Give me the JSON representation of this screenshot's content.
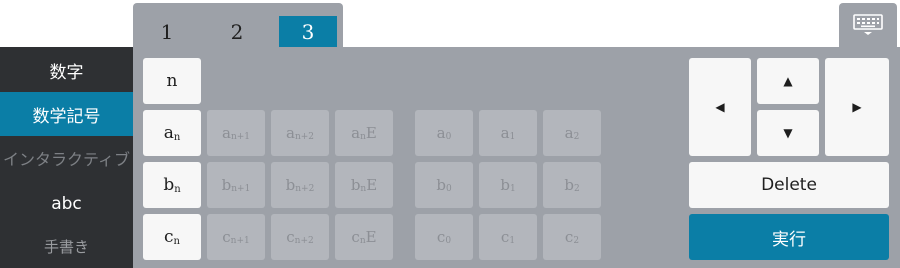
{
  "tabs": [
    {
      "label": "1",
      "active": false
    },
    {
      "label": "2",
      "active": false
    },
    {
      "label": "3",
      "active": true
    }
  ],
  "sidebar": [
    {
      "label": "数字",
      "active": false
    },
    {
      "label": "数学記号",
      "active": true
    },
    {
      "label": "インタラクティブ",
      "active": false,
      "dim": true
    },
    {
      "label": "abc",
      "active": false
    },
    {
      "label": "手書き",
      "active": false,
      "dim": true
    }
  ],
  "keys": {
    "n": "n",
    "a_n": {
      "base": "a",
      "sub": "n"
    },
    "a_n1": {
      "base": "a",
      "sub": "n+1"
    },
    "a_n2": {
      "base": "a",
      "sub": "n+2"
    },
    "a_nE": {
      "base": "a",
      "sub": "n",
      "suffix": "E"
    },
    "a_0": {
      "base": "a",
      "sub": "0"
    },
    "a_1": {
      "base": "a",
      "sub": "1"
    },
    "a_2": {
      "base": "a",
      "sub": "2"
    },
    "b_n": {
      "base": "b",
      "sub": "n"
    },
    "b_n1": {
      "base": "b",
      "sub": "n+1"
    },
    "b_n2": {
      "base": "b",
      "sub": "n+2"
    },
    "b_nE": {
      "base": "b",
      "sub": "n",
      "suffix": "E"
    },
    "b_0": {
      "base": "b",
      "sub": "0"
    },
    "b_1": {
      "base": "b",
      "sub": "1"
    },
    "b_2": {
      "base": "b",
      "sub": "2"
    },
    "c_n": {
      "base": "c",
      "sub": "n"
    },
    "c_n1": {
      "base": "c",
      "sub": "n+1"
    },
    "c_n2": {
      "base": "c",
      "sub": "n+2"
    },
    "c_nE": {
      "base": "c",
      "sub": "n",
      "suffix": "E"
    },
    "c_0": {
      "base": "c",
      "sub": "0"
    },
    "c_1": {
      "base": "c",
      "sub": "1"
    },
    "c_2": {
      "base": "c",
      "sub": "2"
    }
  },
  "nav": {
    "left": "◀",
    "up": "▲",
    "down": "▼",
    "right": "▶"
  },
  "actions": {
    "delete_label": "Delete",
    "run_label": "実行"
  },
  "icons": {
    "keyboard": "keyboard-toggle-icon"
  },
  "colors": {
    "accent": "#0b7ea6",
    "sidebar_bg": "#2e3033",
    "panel_bg": "#9da1a8",
    "key_bg": "#f7f7f7",
    "key_disabled_bg": "#b3b6bc"
  }
}
